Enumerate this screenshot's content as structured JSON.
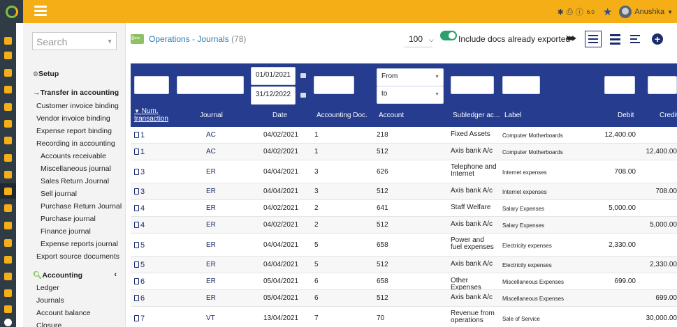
{
  "app": {
    "version": "6.0",
    "user": "Anushka",
    "colors": {
      "topbar": "#f6ae17",
      "rail": "#2f3b45",
      "table_header": "#263c8e",
      "link": "#2c7bb5",
      "toggle_on": "#2c9f6e"
    }
  },
  "menu": {
    "search_placeholder": "Search",
    "setup": "Setup",
    "transfer_section": "Transfer in accounting",
    "transfer_items": [
      "Customer invoice binding",
      "Vendor invoice binding",
      "Expense report binding",
      "Recording in accounting"
    ],
    "recording_items": [
      "Accounts receivable",
      "Miscellaneous journal",
      "Sales Return Journal",
      "Sell journal",
      "Purchase Return Journal",
      "Purchase journal",
      "Finance journal",
      "Expense reports journal"
    ],
    "export_source": "Export source documents",
    "accounting_section": "Accounting",
    "accounting_items": [
      "Ledger",
      "Journals",
      "Account balance",
      "Closure"
    ]
  },
  "toolbar": {
    "page_title": "Operations - Journals",
    "count": "(78)",
    "limit": "100",
    "include_exported_label": "Include docs already exported",
    "include_exported": true
  },
  "filters": {
    "date_from": "01/01/2021",
    "date_to": "31/12/2022",
    "account_from": "From",
    "account_to": "to"
  },
  "columns": {
    "num_line1": "Num.",
    "num_line2": "transaction",
    "journal": "Journal",
    "date": "Date",
    "accounting_doc": "Accounting Doc.",
    "account": "Account",
    "subledger": "Subledger ac...",
    "label": "Label",
    "debit": "Debit",
    "credit": "Credit"
  },
  "rows": [
    {
      "num": "1",
      "journal": "AC",
      "date": "04/02/2021",
      "doc": "1",
      "account": "218",
      "subledger": "Fixed Assets",
      "label": "Computer Motherboards",
      "debit": "12,400.00",
      "credit": ""
    },
    {
      "num": "1",
      "journal": "AC",
      "date": "04/02/2021",
      "doc": "1",
      "account": "512",
      "subledger": "Axis bank A/c",
      "label": "Computer Motherboards",
      "debit": "",
      "credit": "12,400.00"
    },
    {
      "num": "3",
      "journal": "ER",
      "date": "04/04/2021",
      "doc": "3",
      "account": "626",
      "subledger": "Telephone and Internet",
      "label": "Internet expenses",
      "debit": "708.00",
      "credit": ""
    },
    {
      "num": "3",
      "journal": "ER",
      "date": "04/04/2021",
      "doc": "3",
      "account": "512",
      "subledger": "Axis bank A/c",
      "label": "Internet expenses",
      "debit": "",
      "credit": "708.00"
    },
    {
      "num": "4",
      "journal": "ER",
      "date": "04/02/2021",
      "doc": "2",
      "account": "641",
      "subledger": "Staff Welfare",
      "label": "Salary Expenses",
      "debit": "5,000.00",
      "credit": ""
    },
    {
      "num": "4",
      "journal": "ER",
      "date": "04/02/2021",
      "doc": "2",
      "account": "512",
      "subledger": "Axis bank A/c",
      "label": "Salary Expenses",
      "debit": "",
      "credit": "5,000.00"
    },
    {
      "num": "5",
      "journal": "ER",
      "date": "04/04/2021",
      "doc": "5",
      "account": "658",
      "subledger": "Power and fuel expenses",
      "label": "Electricity expenses",
      "debit": "2,330.00",
      "credit": ""
    },
    {
      "num": "5",
      "journal": "ER",
      "date": "04/04/2021",
      "doc": "5",
      "account": "512",
      "subledger": "Axis bank A/c",
      "label": "Electricity expenses",
      "debit": "",
      "credit": "2,330.00"
    },
    {
      "num": "6",
      "journal": "ER",
      "date": "05/04/2021",
      "doc": "6",
      "account": "658",
      "subledger": "Other Expenses",
      "label": "Miscellaneous Expenses",
      "debit": "699.00",
      "credit": ""
    },
    {
      "num": "6",
      "journal": "ER",
      "date": "05/04/2021",
      "doc": "6",
      "account": "512",
      "subledger": "Axis bank A/c",
      "label": "Miscellaneous Expenses",
      "debit": "",
      "credit": "699.00"
    },
    {
      "num": "7",
      "journal": "VT",
      "date": "13/04/2021",
      "doc": "7",
      "account": "70",
      "subledger": "Revenue from operations",
      "label": "Sale of Service",
      "debit": "",
      "credit": "30,000.00"
    }
  ]
}
